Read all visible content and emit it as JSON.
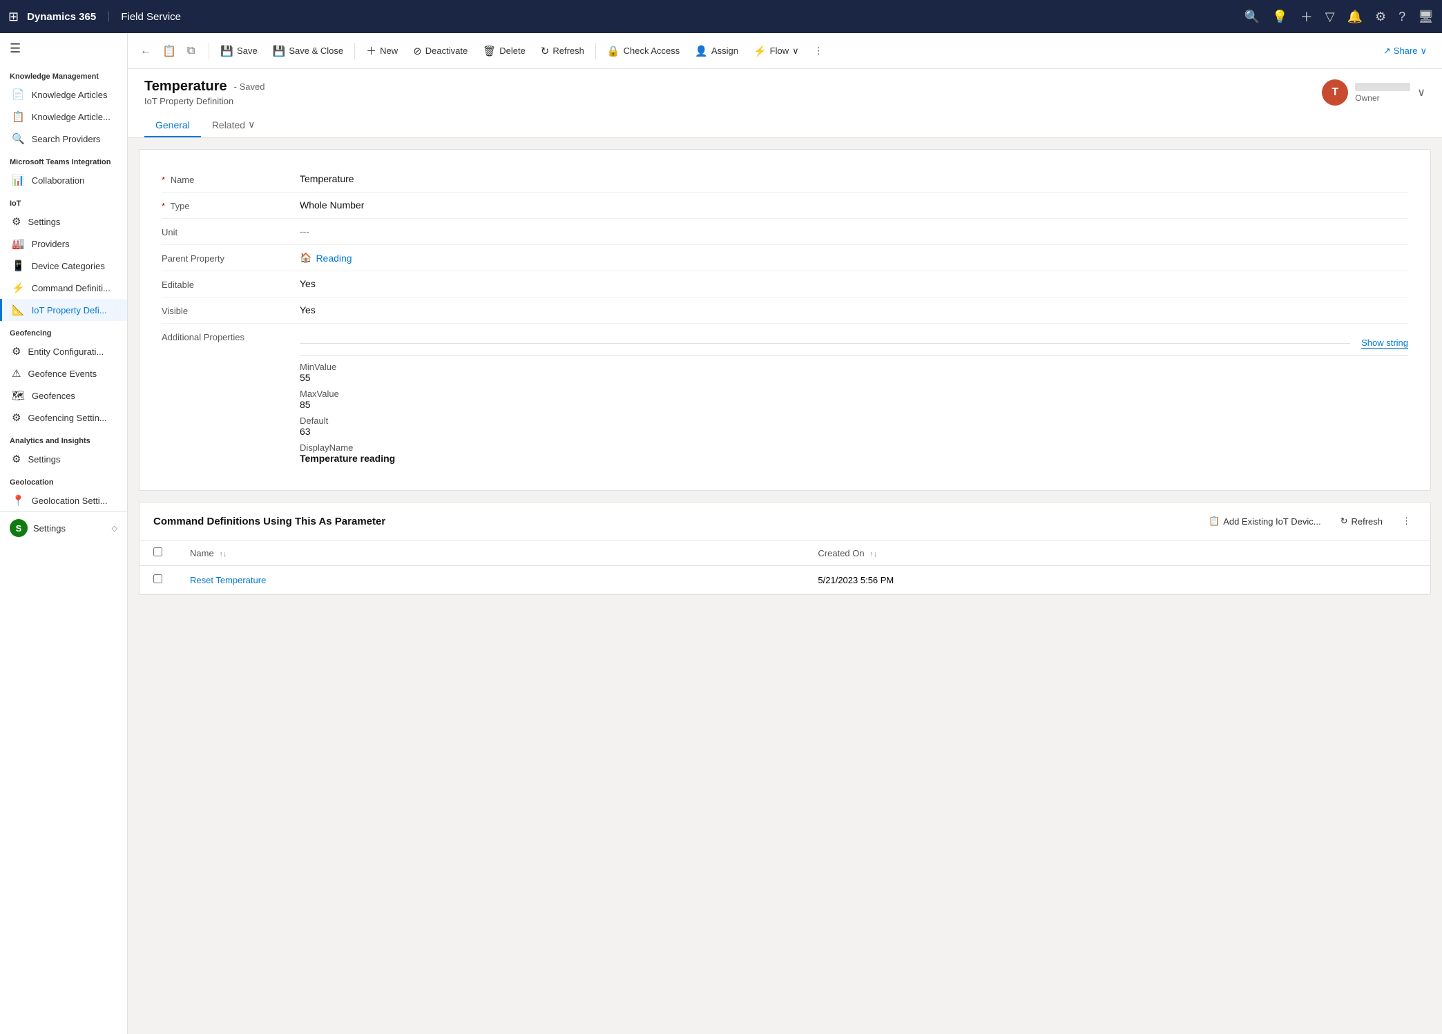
{
  "topNav": {
    "gridIcon": "⊞",
    "appTitle": "Dynamics 365",
    "divider": "|",
    "moduleName": "Field Service",
    "icons": [
      "🔍",
      "💡",
      "+",
      "▽",
      "🔔",
      "⚙",
      "?",
      "🖥"
    ]
  },
  "sidebar": {
    "hamburger": "☰",
    "sections": [
      {
        "title": "Knowledge Management",
        "items": [
          {
            "id": "knowledge-articles",
            "icon": "📄",
            "label": "Knowledge Articles"
          },
          {
            "id": "knowledge-articles-2",
            "icon": "📋",
            "label": "Knowledge Article..."
          },
          {
            "id": "search-providers",
            "icon": "🔍",
            "label": "Search Providers"
          }
        ]
      },
      {
        "title": "Microsoft Teams Integration",
        "items": [
          {
            "id": "collaboration",
            "icon": "📊",
            "label": "Collaboration"
          }
        ]
      },
      {
        "title": "IoT",
        "items": [
          {
            "id": "settings",
            "icon": "⚙",
            "label": "Settings"
          },
          {
            "id": "providers",
            "icon": "🏭",
            "label": "Providers"
          },
          {
            "id": "device-categories",
            "icon": "📱",
            "label": "Device Categories"
          },
          {
            "id": "command-definitions",
            "icon": "⚡",
            "label": "Command Definiti..."
          },
          {
            "id": "iot-property-def",
            "icon": "📐",
            "label": "IoT Property Defi...",
            "active": true
          }
        ]
      },
      {
        "title": "Geofencing",
        "items": [
          {
            "id": "entity-config",
            "icon": "⚙",
            "label": "Entity Configurati..."
          },
          {
            "id": "geofence-events",
            "icon": "⚠",
            "label": "Geofence Events"
          },
          {
            "id": "geofences",
            "icon": "🗺",
            "label": "Geofences"
          },
          {
            "id": "geofencing-settings",
            "icon": "⚙",
            "label": "Geofencing Settin..."
          }
        ]
      },
      {
        "title": "Analytics and Insights",
        "items": [
          {
            "id": "analytics-settings",
            "icon": "⚙",
            "label": "Settings"
          }
        ]
      },
      {
        "title": "Geolocation",
        "items": [
          {
            "id": "geolocation-settings",
            "icon": "📍",
            "label": "Geolocation Setti..."
          }
        ]
      }
    ],
    "bottomItem": {
      "id": "bottom-settings",
      "icon": "S",
      "label": "Settings",
      "chevron": "◇"
    }
  },
  "toolbar": {
    "backBtn": "←",
    "clipboardIcon": "📋",
    "expandIcon": "⧉",
    "buttons": [
      {
        "id": "save-btn",
        "icon": "💾",
        "label": "Save"
      },
      {
        "id": "save-close-btn",
        "icon": "💾",
        "label": "Save & Close"
      },
      {
        "id": "new-btn",
        "icon": "+",
        "label": "New"
      },
      {
        "id": "deactivate-btn",
        "icon": "⊘",
        "label": "Deactivate"
      },
      {
        "id": "delete-btn",
        "icon": "🗑",
        "label": "Delete"
      },
      {
        "id": "refresh-btn",
        "icon": "↻",
        "label": "Refresh"
      },
      {
        "id": "check-access-btn",
        "icon": "🔒",
        "label": "Check Access"
      },
      {
        "id": "assign-btn",
        "icon": "👤",
        "label": "Assign"
      },
      {
        "id": "flow-btn",
        "icon": "⚡",
        "label": "Flow"
      }
    ],
    "moreIcon": "⋮",
    "flowChevron": "∨",
    "shareBtn": {
      "icon": "↗",
      "label": "Share"
    },
    "shareChevron": "∨"
  },
  "pageHeader": {
    "title": "Temperature",
    "savedBadge": "- Saved",
    "subtitle": "IoT Property Definition",
    "owner": {
      "initial": "T",
      "avatarBg": "#c84b2f",
      "name": "Redacted",
      "label": "Owner"
    }
  },
  "tabs": [
    {
      "id": "general-tab",
      "label": "General",
      "active": true
    },
    {
      "id": "related-tab",
      "label": "Related",
      "hasChevron": true
    }
  ],
  "form": {
    "fields": [
      {
        "id": "name-field",
        "label": "Name",
        "required": true,
        "value": "Temperature",
        "type": "text"
      },
      {
        "id": "type-field",
        "label": "Type",
        "required": true,
        "value": "Whole Number",
        "type": "text"
      },
      {
        "id": "unit-field",
        "label": "Unit",
        "required": false,
        "value": "---",
        "type": "muted"
      },
      {
        "id": "parent-property-field",
        "label": "Parent Property",
        "required": false,
        "value": "Reading",
        "type": "link"
      },
      {
        "id": "editable-field",
        "label": "Editable",
        "required": false,
        "value": "Yes",
        "type": "text"
      },
      {
        "id": "visible-field",
        "label": "Visible",
        "required": false,
        "value": "Yes",
        "type": "text"
      }
    ],
    "additionalProperties": {
      "label": "Additional Properties",
      "showStringBtn": "Show string",
      "subFields": [
        {
          "id": "min-value",
          "label": "MinValue",
          "value": "55"
        },
        {
          "id": "max-value",
          "label": "MaxValue",
          "value": "85"
        },
        {
          "id": "default-value",
          "label": "Default",
          "value": "63"
        },
        {
          "id": "display-name",
          "label": "DisplayName",
          "value": "Temperature reading"
        }
      ]
    }
  },
  "commandSection": {
    "title": "Command Definitions Using This As Parameter",
    "actions": [
      {
        "id": "add-existing-btn",
        "icon": "📋",
        "label": "Add Existing IoT Devic..."
      },
      {
        "id": "section-refresh-btn",
        "icon": "↻",
        "label": "Refresh"
      },
      {
        "id": "section-more-btn",
        "icon": "⋮",
        "label": ""
      }
    ],
    "columns": [
      {
        "id": "col-select",
        "label": ""
      },
      {
        "id": "col-name",
        "label": "Name",
        "sortable": true
      },
      {
        "id": "col-created-on",
        "label": "Created On",
        "sortable": true
      }
    ],
    "rows": [
      {
        "id": "row-1",
        "name": "Reset Temperature",
        "createdOn": "5/21/2023 5:56 PM"
      }
    ]
  }
}
